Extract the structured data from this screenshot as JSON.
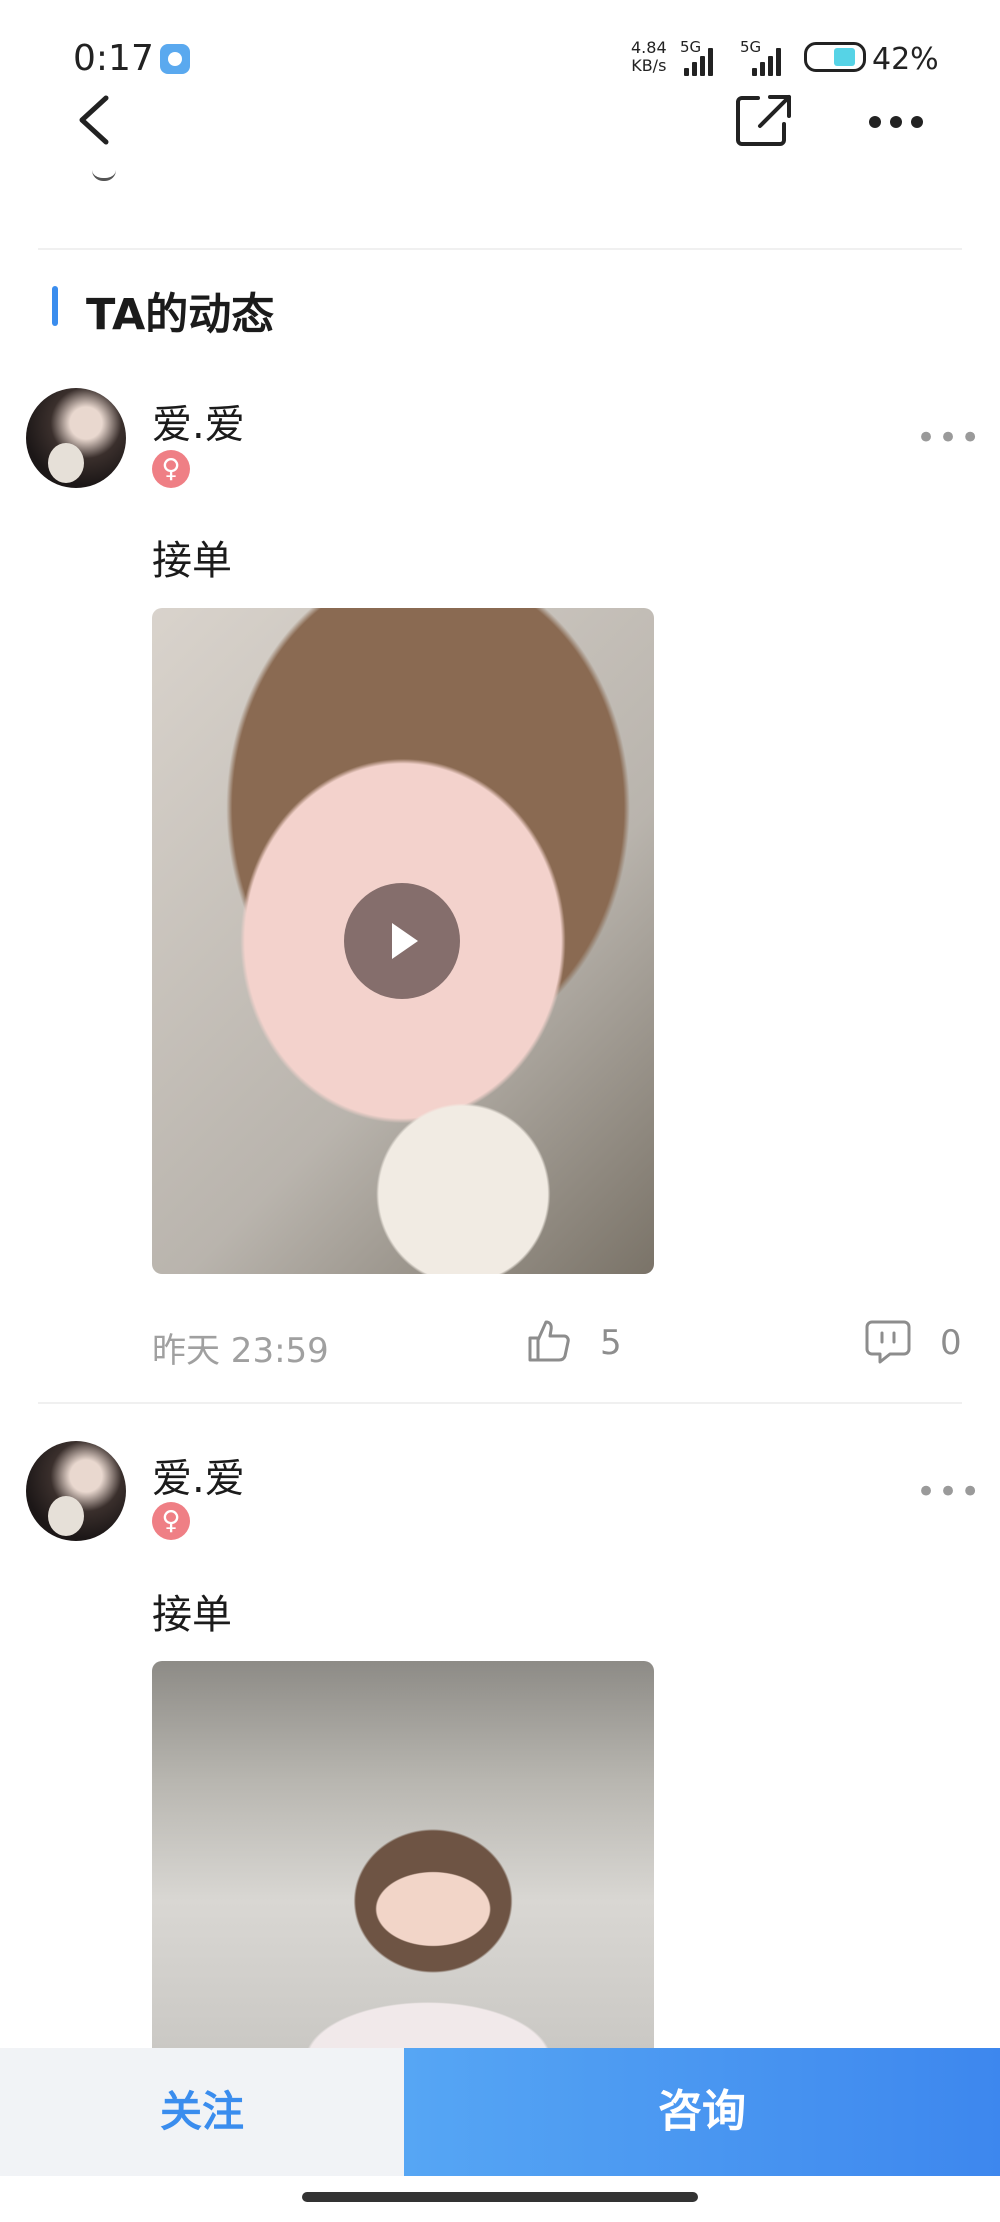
{
  "status_bar": {
    "time": "0:17",
    "net_speed_value": "4.84",
    "net_speed_unit": "KB/s",
    "signal1": "5G",
    "signal2": "5G",
    "battery": "42%"
  },
  "section": {
    "title": "TA的动态"
  },
  "posts": [
    {
      "username": "爱.爱",
      "gender_symbol": "♀",
      "text": "接单",
      "media_type": "video",
      "time": "昨天 23:59",
      "likes": "5",
      "comments": "0"
    },
    {
      "username": "爱.爱",
      "gender_symbol": "♀",
      "text": "接单",
      "media_type": "image"
    }
  ],
  "bottom_bar": {
    "follow_label": "关注",
    "consult_label": "咨询"
  },
  "colors": {
    "accent": "#3a8dee",
    "gender_female": "#ef7f85"
  }
}
